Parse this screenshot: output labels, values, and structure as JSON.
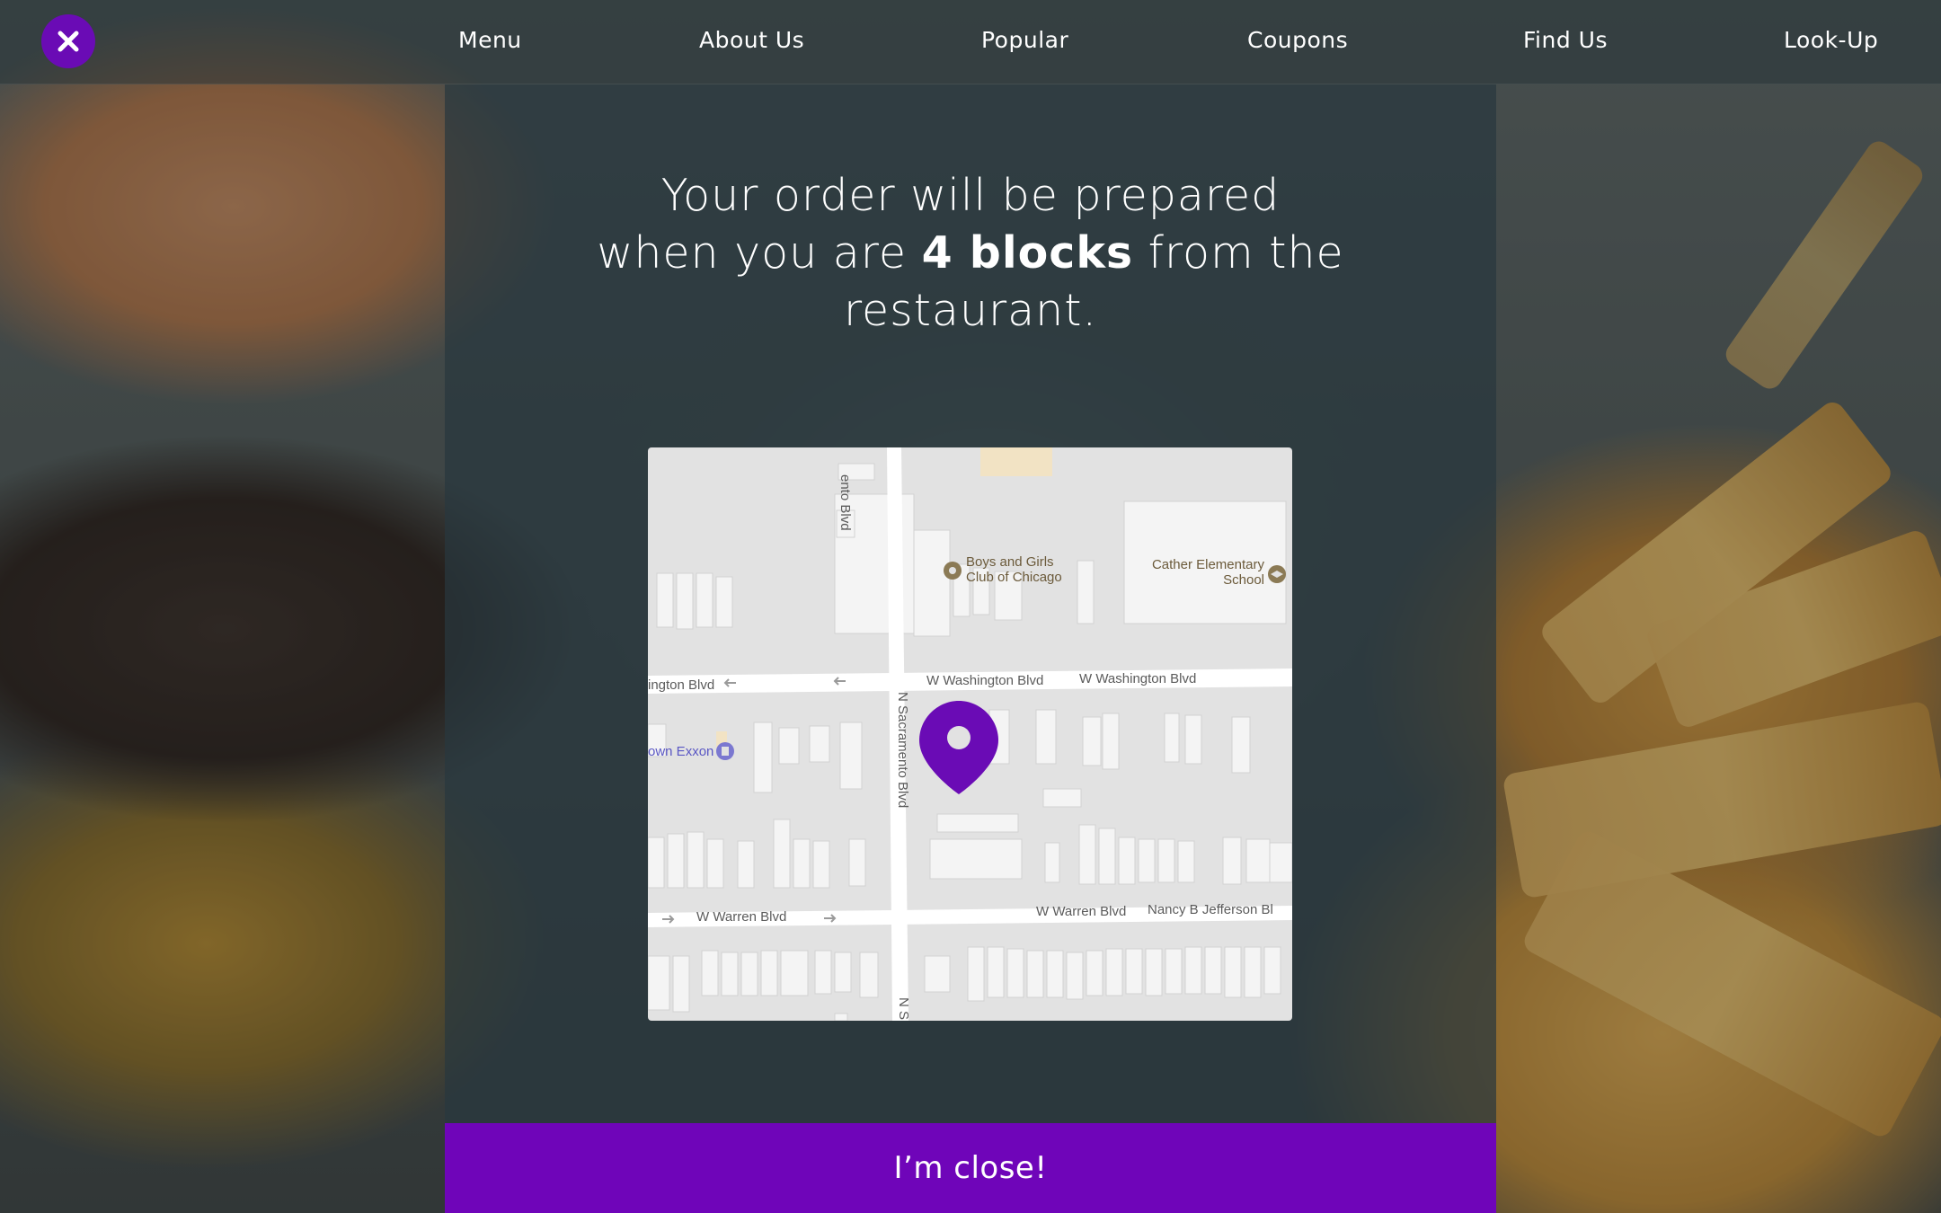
{
  "nav": {
    "items": [
      {
        "label": "Menu"
      },
      {
        "label": "About Us"
      },
      {
        "label": "Popular"
      },
      {
        "label": "Coupons"
      },
      {
        "label": "Find Us"
      },
      {
        "label": "Look-Up"
      }
    ]
  },
  "headline": {
    "line1": "Your order will be prepared",
    "line2_pre": "when you are ",
    "line2_bold": "4 blocks",
    "line2_post": " from the",
    "line3": "restaurant."
  },
  "map": {
    "streets": {
      "washington_left": "ington Blvd",
      "washington_mid": "W Washington Blvd",
      "washington_right": "W Washington Blvd",
      "sacramento_top": "ento Blvd",
      "sacramento_mid": "N Sacramento Blvd",
      "sacramento_bottom": "N S",
      "warren_left": "W Warren Blvd",
      "warren_right": "W Warren Blvd",
      "jefferson": "Nancy B Jefferson Bl"
    },
    "pois": {
      "boys_girls_club": "Boys and Girls Club of Chicago",
      "boys_girls_club_l1": "Boys and Girls",
      "boys_girls_club_l2": "Club of Chicago",
      "cather_school_l1": "Cather Elementary",
      "cather_school_l2": "School",
      "exxon": "own Exxon"
    },
    "pin_color": "#6a0bb5"
  },
  "cta": {
    "label": "I’m close!"
  },
  "colors": {
    "accent": "#6f05b9",
    "close_button": "#6a0bb5"
  }
}
